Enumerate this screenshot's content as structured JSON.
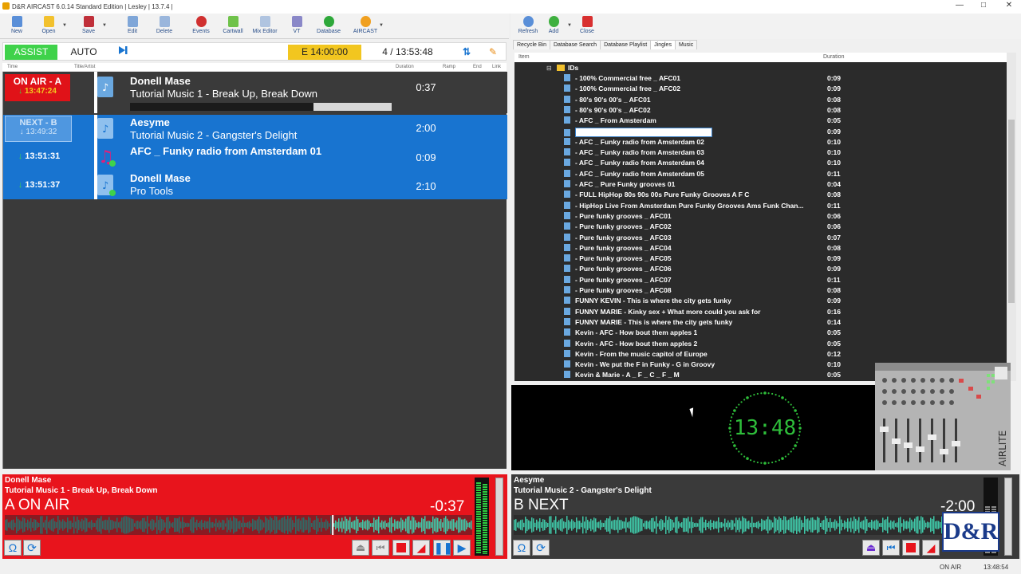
{
  "window": {
    "title": "D&R AIRCAST 6.0.14 Standard Edition | Lesley | 13.7.4 |"
  },
  "toolbar": {
    "new": "New",
    "open": "Open",
    "save": "Save",
    "edit": "Edit",
    "delete": "Delete",
    "events": "Events",
    "cartwall": "Cartwall",
    "mix_editor": "Mix Editor",
    "vt": "VT",
    "database": "Database",
    "aircast": "AIRCAST"
  },
  "right_toolbar": {
    "refresh": "Refresh",
    "add": "Add",
    "close": "Close"
  },
  "control": {
    "assist": "ASSIST",
    "auto": "AUTO",
    "end_time": "E  14:00:00",
    "count_time": "4 / 13:53:48"
  },
  "columns": {
    "time": "Time",
    "title_artist": "Title/Artist",
    "duration": "Duration",
    "ramp": "Ramp",
    "end": "End",
    "link": "Link"
  },
  "playlist": [
    {
      "status": "ON AIR - A",
      "time": "13:47:24",
      "artist": "Donell Mase",
      "song": "Tutorial Music 1 - Break Up, Break Down",
      "duration": "0:37",
      "progress": 0.7
    },
    {
      "status": "NEXT - B",
      "time": "13:49:32",
      "artist": "Aesyme",
      "song": "Tutorial Music 2 - Gangster's Delight",
      "duration": "2:00"
    },
    {
      "status": "",
      "time": "13:51:31",
      "artist": "AFC _ Funky radio from Amsterdam 01",
      "song": "",
      "duration": "0:09"
    },
    {
      "status": "",
      "time": "13:51:37",
      "artist": "Donell Mase",
      "song": "Pro Tools",
      "duration": "2:10"
    }
  ],
  "library_tabs": [
    "Recycle Bin",
    "Database Search",
    "Database Playlist",
    "Jingles",
    "Music"
  ],
  "library_active_tab": "Jingles",
  "library_columns": {
    "item": "Item",
    "duration": "Duration"
  },
  "library": {
    "folder": "IDs",
    "items": [
      {
        "name": "- 100% Commercial free _ AFC01",
        "dur": "0:09"
      },
      {
        "name": "- 100% Commercial free _ AFC02",
        "dur": "0:09"
      },
      {
        "name": "- 80's 90's 00's _ AFC01",
        "dur": "0:08"
      },
      {
        "name": "- 80's 90's 00's _ AFC02",
        "dur": "0:08"
      },
      {
        "name": "- AFC _ From Amsterdam",
        "dur": "0:05"
      },
      {
        "name": "",
        "dur": "0:09"
      },
      {
        "name": "- AFC _ Funky radio from Amsterdam 02",
        "dur": "0:10"
      },
      {
        "name": "- AFC _ Funky radio from Amsterdam 03",
        "dur": "0:10"
      },
      {
        "name": "- AFC _ Funky radio from Amsterdam 04",
        "dur": "0:10"
      },
      {
        "name": "- AFC _ Funky radio from Amsterdam 05",
        "dur": "0:11"
      },
      {
        "name": "- AFC _ Pure Funky grooves 01",
        "dur": "0:04"
      },
      {
        "name": "- FULL HipHop 80s 90s 00s Pure Funky Grooves A F C",
        "dur": "0:08"
      },
      {
        "name": "- HipHop Live From Amsterdam Pure Funky Grooves Ams Funk Chan...",
        "dur": "0:11"
      },
      {
        "name": "- Pure funky grooves _ AFC01",
        "dur": "0:06"
      },
      {
        "name": "- Pure funky grooves _ AFC02",
        "dur": "0:06"
      },
      {
        "name": "- Pure funky grooves _ AFC03",
        "dur": "0:07"
      },
      {
        "name": "- Pure funky grooves _ AFC04",
        "dur": "0:08"
      },
      {
        "name": "- Pure funky grooves _ AFC05",
        "dur": "0:09"
      },
      {
        "name": "- Pure funky grooves _ AFC06",
        "dur": "0:09"
      },
      {
        "name": "- Pure funky grooves _ AFC07",
        "dur": "0:11"
      },
      {
        "name": "- Pure funky grooves _ AFC08",
        "dur": "0:08"
      },
      {
        "name": "FUNNY KEVIN - This is where the city gets funky",
        "dur": "0:09"
      },
      {
        "name": "FUNNY MARIE - Kinky sex + What more could you ask for",
        "dur": "0:16"
      },
      {
        "name": "FUNNY MARIE - This is where the city gets funky",
        "dur": "0:14"
      },
      {
        "name": "Kevin - AFC - How bout them apples 1",
        "dur": "0:05"
      },
      {
        "name": "Kevin - AFC - How bout them apples 2",
        "dur": "0:05"
      },
      {
        "name": "Kevin - From the music capitol of Europe",
        "dur": "0:12"
      },
      {
        "name": "Kevin - We put the F in Funky - G in Groovy",
        "dur": "0:10"
      },
      {
        "name": "Kevin & Marie - A _ F _ C _ F _ M",
        "dur": "0:05"
      }
    ]
  },
  "clock": "13:48",
  "mixer_label": "AIRLITE",
  "player_a": {
    "artist": "Donell Mase",
    "song": "Tutorial Music 1 - Break Up, Break Down",
    "state": "A ON AIR",
    "remain": "-0:37",
    "progress": 0.7,
    "color": "#e8141c"
  },
  "player_b": {
    "artist": "Aesyme",
    "song": "Tutorial Music 2 - Gangster's Delight",
    "state": "B NEXT",
    "remain": "-2:00",
    "logo": "D&R"
  },
  "status": {
    "on_air": "ON AIR",
    "time": "13:48:54"
  },
  "colors": {
    "accent_green": "#3fd24a",
    "selected_blue": "#1874d0",
    "on_air_red": "#e8141c",
    "end_yellow": "#f2c61f",
    "wave_teal": "#3fc8a8"
  }
}
